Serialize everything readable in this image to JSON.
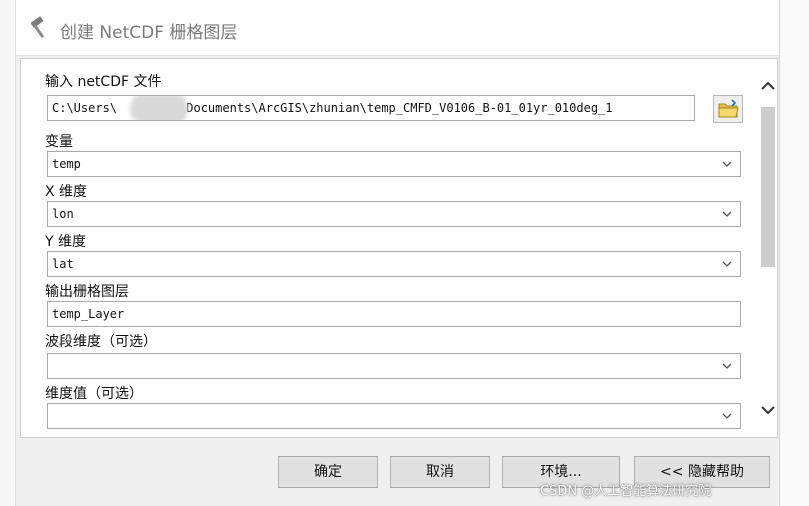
{
  "window": {
    "title": "创建 NetCDF 栅格图层"
  },
  "fields": {
    "input_netcdf": {
      "label": "输入 netCDF 文件",
      "value_prefix": "C:\\Users\\",
      "value_suffix": "\\Documents\\ArcGIS\\zhunian\\temp_CMFD_V0106_B-01_01yr_010deg_1"
    },
    "variable": {
      "label": "变量",
      "value": "temp"
    },
    "x_dimension": {
      "label": "X 维度",
      "value": "lon"
    },
    "y_dimension": {
      "label": "Y 维度",
      "value": "lat"
    },
    "output_raster": {
      "label": "输出栅格图层",
      "value": "temp_Layer"
    },
    "band_dimension": {
      "label": "波段维度（可选）",
      "value": ""
    },
    "dimension_values": {
      "label": "维度值（可选）",
      "value": ""
    }
  },
  "buttons": {
    "ok": "确定",
    "cancel": "取消",
    "environments": "环境...",
    "hide_help": "<< 隐藏帮助"
  },
  "watermark": "CSDN @人工智能算法研究院",
  "icons": [
    "hammer-icon",
    "folder-open-icon",
    "chevron-down-icon",
    "scroll-up-icon",
    "scroll-down-icon"
  ]
}
